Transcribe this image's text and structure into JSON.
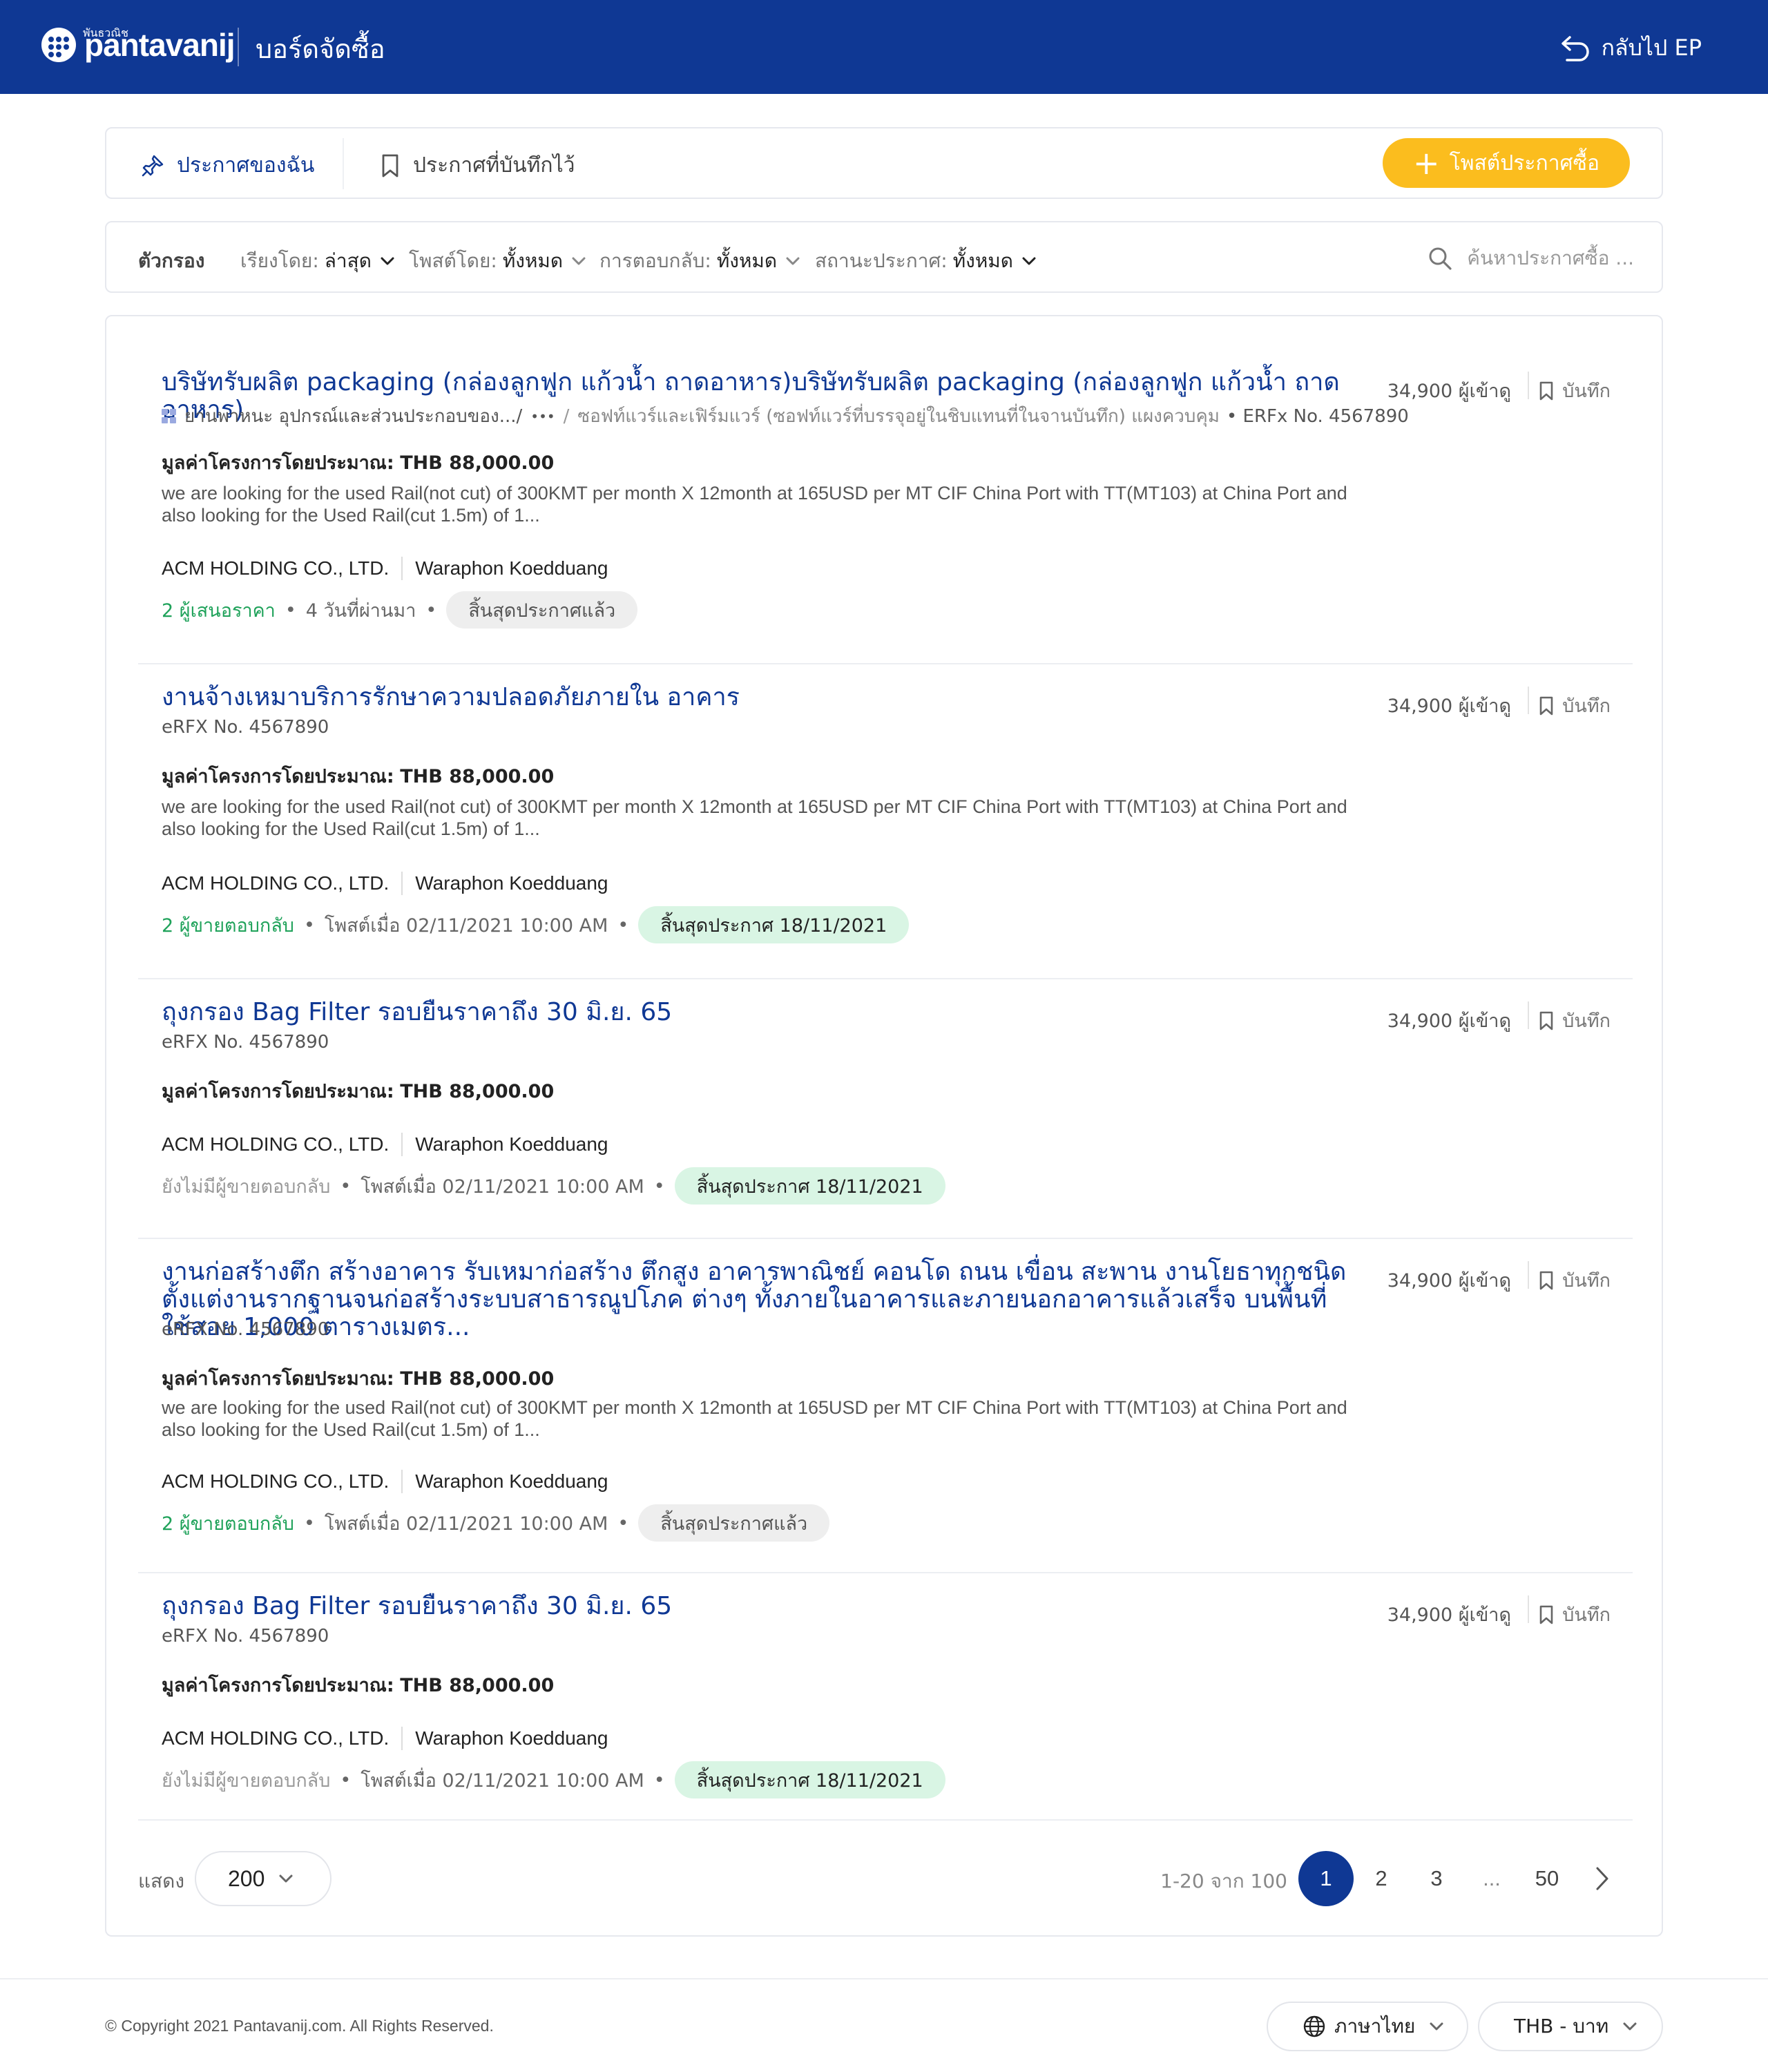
{
  "header": {
    "logo_small": "พันธวณิช",
    "logo_text": "pantavanij",
    "title": "บอร์ดจัดซื้อ",
    "back_label": "กลับไป EP",
    "bg_color": "#0f3894"
  },
  "tabs": {
    "mine": "ประกาศของฉัน",
    "saved": "ประกาศที่บันทึกไว้",
    "post_button": "โพสต์ประกาศซื้อ",
    "accent_color": "#fbbd1e"
  },
  "filters": {
    "label": "ตัวกรอง",
    "sort_label": "เรียงโดย:",
    "sort_value": "ล่าสุด",
    "posted_by_label": "โพสต์โดย:",
    "posted_by_value": "ทั้งหมด",
    "response_label": "การตอบกลับ:",
    "response_value": "ทั้งหมด",
    "status_label": "สถานะประกาศ:",
    "status_value": "ทั้งหมด",
    "search_placeholder": "ค้นหาประกาศซื้อ ..."
  },
  "items": [
    {
      "title": "บริษัทรับผลิต packaging (กล่องลูกฟูก แก้วน้ำ ถาดอาหาร)บริษัทรับผลิต packaging (กล่องลูกฟูก แก้วน้ำ ถาดอาหาร)",
      "category": "ยานพาหนะ อุปกรณ์และส่วนประกอบของ.../",
      "ellipsis": "•••",
      "sub_category": "ซอฟท์แวร์และเฟิร์มแวร์ (ซอฟท์แวร์ที่บรรจุอยู่ในชิบแทนที่ในจานบันทึก) แผงควบคุม",
      "erfx": "• ERFx No. 4567890",
      "value_label": "มูลค่าโครงการโดยประมาณ:",
      "value": "THB 88,000.00",
      "description": "we are looking for the used Rail(not cut) of 300KMT per month X 12month at 165USD per MT CIF China Port with TT(MT103) at China Port and also looking for the Used Rail(cut 1.5m) of 1...",
      "company": "ACM HOLDING CO., LTD.",
      "contact": "Waraphon Koedduang",
      "responses": "2 ผู้เสนอราคา",
      "posted": "4 วันที่ผ่านมา",
      "status": "สิ้นสุดประกาศแล้ว",
      "views": "34,900 ผู้เข้าดู",
      "save_label": "บันทึก"
    },
    {
      "title": "งานจ้างเหมาบริการรักษาความปลอดภัยภายใน อาคาร",
      "erfx": "eRFX No. 4567890",
      "value_label": "มูลค่าโครงการโดยประมาณ:",
      "value": "THB 88,000.00",
      "description": "we are looking for the used Rail(not cut) of 300KMT per month X 12month at 165USD per MT CIF China Port with TT(MT103) at China Port and also looking for the Used Rail(cut 1.5m) of 1...",
      "company": "ACM HOLDING CO., LTD.",
      "contact": "Waraphon Koedduang",
      "responses": "2 ผู้ขายตอบกลับ",
      "posted": "โพสต์เมื่อ 02/11/2021 10:00 AM",
      "status": "สิ้นสุดประกาศ 18/11/2021",
      "views": "34,900 ผู้เข้าดู",
      "save_label": "บันทึก"
    },
    {
      "title": "ถุงกรอง Bag Filter รอบยืนราคาถึง 30 มิ.ย. 65",
      "erfx": "eRFX No. 4567890",
      "value_label": "มูลค่าโครงการโดยประมาณ:",
      "value": "THB 88,000.00",
      "company": "ACM HOLDING CO., LTD.",
      "contact": "Waraphon Koedduang",
      "responses": "ยังไม่มีผู้ขายตอบกลับ",
      "posted": "โพสต์เมื่อ 02/11/2021 10:00 AM",
      "status": "สิ้นสุดประกาศ 18/11/2021",
      "views": "34,900 ผู้เข้าดู",
      "save_label": "บันทึก"
    },
    {
      "title": "งานก่อสร้างตึก สร้างอาคาร รับเหมาก่อสร้าง ตึกสูง อาคารพาณิชย์ คอนโด ถนน เขื่อน สะพาน งานโยธาทุกชนิดตั้งแต่งานรากฐานจนก่อสร้างระบบสาธารณูปโภค ต่างๆ ทั้งภายในอาคารและภายนอกอาคารแล้วเสร็จ บนพื้นที่ ใช้สอย 1,000 ตารางเมตร...",
      "erfx": "eRFX No. 4567890",
      "value_label": "มูลค่าโครงการโดยประมาณ:",
      "value": "THB 88,000.00",
      "description": "we are looking for the used Rail(not cut) of 300KMT per month X 12month at 165USD per MT CIF China Port with TT(MT103) at China Port and also looking for the Used Rail(cut 1.5m) of 1...",
      "company": "ACM HOLDING CO., LTD.",
      "contact": "Waraphon Koedduang",
      "responses": "2 ผู้ขายตอบกลับ",
      "posted": "โพสต์เมื่อ 02/11/2021 10:00 AM",
      "status": "สิ้นสุดประกาศแล้ว",
      "views": "34,900 ผู้เข้าดู",
      "save_label": "บันทึก"
    },
    {
      "title": "ถุงกรอง Bag Filter รอบยืนราคาถึง 30 มิ.ย. 65",
      "erfx": "eRFX No. 4567890",
      "value_label": "มูลค่าโครงการโดยประมาณ:",
      "value": "THB 88,000.00",
      "company": "ACM HOLDING CO., LTD.",
      "contact": "Waraphon Koedduang",
      "responses": "ยังไม่มีผู้ขายตอบกลับ",
      "posted": "โพสต์เมื่อ 02/11/2021 10:00 AM",
      "status": "สิ้นสุดประกาศ 18/11/2021",
      "views": "34,900 ผู้เข้าดู",
      "save_label": "บันทึก"
    }
  ],
  "pagination": {
    "show_label": "แสดง",
    "page_size": "200",
    "range": "1-20 จาก 100",
    "pages": [
      "1",
      "2",
      "3",
      "...",
      "50"
    ],
    "current": "1"
  },
  "footer": {
    "copyright": "© Copyright 2021 Pantavanij.com. All Rights Reserved.",
    "language": "ภาษาไทย",
    "currency": "THB - บาท"
  }
}
